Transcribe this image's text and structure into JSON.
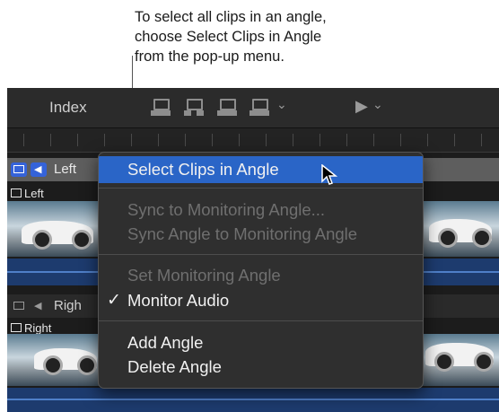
{
  "callout": {
    "text": "To select all clips in an angle,\nchoose Select Clips in Angle\nfrom the pop-up menu."
  },
  "toolbar": {
    "index_label": "Index",
    "icons": [
      "append-icon",
      "insert-icon",
      "connect-icon",
      "overwrite-icon",
      "tool-select-icon"
    ]
  },
  "angles": [
    {
      "header_label": "Left",
      "clip_label": "Left"
    },
    {
      "header_label": "Righ",
      "clip_label": "Right"
    }
  ],
  "menu": {
    "items": [
      {
        "label": "Select Clips in Angle",
        "state": "highlighted"
      },
      {
        "label": "Sync to Monitoring Angle...",
        "state": "disabled"
      },
      {
        "label": "Sync Angle to Monitoring Angle",
        "state": "disabled"
      },
      {
        "label": "Set Monitoring Angle",
        "state": "disabled"
      },
      {
        "label": "Monitor Audio",
        "state": "checked",
        "check": "✓"
      },
      {
        "label": "Add Angle",
        "state": "enabled"
      },
      {
        "label": "Delete Angle",
        "state": "enabled"
      }
    ]
  },
  "colors": {
    "highlight": "#2a65c7",
    "angle_button_active": "#3563d9",
    "menu_background": "#2f2f2f"
  }
}
